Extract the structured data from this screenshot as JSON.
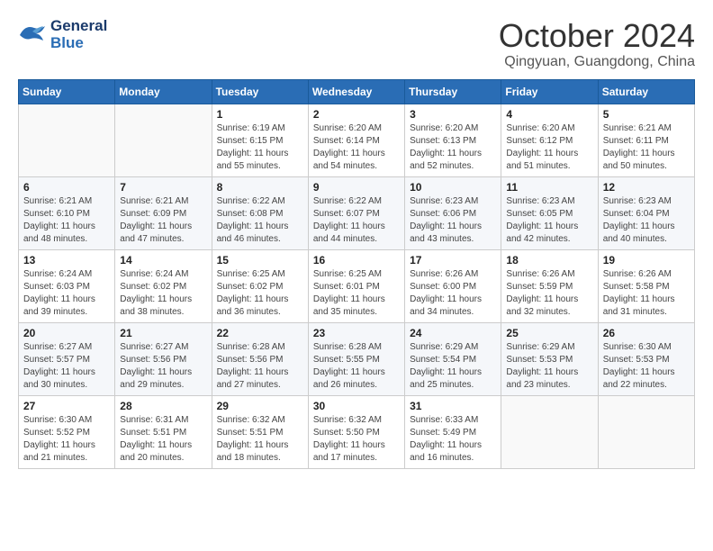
{
  "logo": {
    "line1": "General",
    "line2": "Blue"
  },
  "title": "October 2024",
  "location": "Qingyuan, Guangdong, China",
  "days_of_week": [
    "Sunday",
    "Monday",
    "Tuesday",
    "Wednesday",
    "Thursday",
    "Friday",
    "Saturday"
  ],
  "weeks": [
    [
      {
        "day": "",
        "info": ""
      },
      {
        "day": "",
        "info": ""
      },
      {
        "day": "1",
        "info": "Sunrise: 6:19 AM\nSunset: 6:15 PM\nDaylight: 11 hours and 55 minutes."
      },
      {
        "day": "2",
        "info": "Sunrise: 6:20 AM\nSunset: 6:14 PM\nDaylight: 11 hours and 54 minutes."
      },
      {
        "day": "3",
        "info": "Sunrise: 6:20 AM\nSunset: 6:13 PM\nDaylight: 11 hours and 52 minutes."
      },
      {
        "day": "4",
        "info": "Sunrise: 6:20 AM\nSunset: 6:12 PM\nDaylight: 11 hours and 51 minutes."
      },
      {
        "day": "5",
        "info": "Sunrise: 6:21 AM\nSunset: 6:11 PM\nDaylight: 11 hours and 50 minutes."
      }
    ],
    [
      {
        "day": "6",
        "info": "Sunrise: 6:21 AM\nSunset: 6:10 PM\nDaylight: 11 hours and 48 minutes."
      },
      {
        "day": "7",
        "info": "Sunrise: 6:21 AM\nSunset: 6:09 PM\nDaylight: 11 hours and 47 minutes."
      },
      {
        "day": "8",
        "info": "Sunrise: 6:22 AM\nSunset: 6:08 PM\nDaylight: 11 hours and 46 minutes."
      },
      {
        "day": "9",
        "info": "Sunrise: 6:22 AM\nSunset: 6:07 PM\nDaylight: 11 hours and 44 minutes."
      },
      {
        "day": "10",
        "info": "Sunrise: 6:23 AM\nSunset: 6:06 PM\nDaylight: 11 hours and 43 minutes."
      },
      {
        "day": "11",
        "info": "Sunrise: 6:23 AM\nSunset: 6:05 PM\nDaylight: 11 hours and 42 minutes."
      },
      {
        "day": "12",
        "info": "Sunrise: 6:23 AM\nSunset: 6:04 PM\nDaylight: 11 hours and 40 minutes."
      }
    ],
    [
      {
        "day": "13",
        "info": "Sunrise: 6:24 AM\nSunset: 6:03 PM\nDaylight: 11 hours and 39 minutes."
      },
      {
        "day": "14",
        "info": "Sunrise: 6:24 AM\nSunset: 6:02 PM\nDaylight: 11 hours and 38 minutes."
      },
      {
        "day": "15",
        "info": "Sunrise: 6:25 AM\nSunset: 6:02 PM\nDaylight: 11 hours and 36 minutes."
      },
      {
        "day": "16",
        "info": "Sunrise: 6:25 AM\nSunset: 6:01 PM\nDaylight: 11 hours and 35 minutes."
      },
      {
        "day": "17",
        "info": "Sunrise: 6:26 AM\nSunset: 6:00 PM\nDaylight: 11 hours and 34 minutes."
      },
      {
        "day": "18",
        "info": "Sunrise: 6:26 AM\nSunset: 5:59 PM\nDaylight: 11 hours and 32 minutes."
      },
      {
        "day": "19",
        "info": "Sunrise: 6:26 AM\nSunset: 5:58 PM\nDaylight: 11 hours and 31 minutes."
      }
    ],
    [
      {
        "day": "20",
        "info": "Sunrise: 6:27 AM\nSunset: 5:57 PM\nDaylight: 11 hours and 30 minutes."
      },
      {
        "day": "21",
        "info": "Sunrise: 6:27 AM\nSunset: 5:56 PM\nDaylight: 11 hours and 29 minutes."
      },
      {
        "day": "22",
        "info": "Sunrise: 6:28 AM\nSunset: 5:56 PM\nDaylight: 11 hours and 27 minutes."
      },
      {
        "day": "23",
        "info": "Sunrise: 6:28 AM\nSunset: 5:55 PM\nDaylight: 11 hours and 26 minutes."
      },
      {
        "day": "24",
        "info": "Sunrise: 6:29 AM\nSunset: 5:54 PM\nDaylight: 11 hours and 25 minutes."
      },
      {
        "day": "25",
        "info": "Sunrise: 6:29 AM\nSunset: 5:53 PM\nDaylight: 11 hours and 23 minutes."
      },
      {
        "day": "26",
        "info": "Sunrise: 6:30 AM\nSunset: 5:53 PM\nDaylight: 11 hours and 22 minutes."
      }
    ],
    [
      {
        "day": "27",
        "info": "Sunrise: 6:30 AM\nSunset: 5:52 PM\nDaylight: 11 hours and 21 minutes."
      },
      {
        "day": "28",
        "info": "Sunrise: 6:31 AM\nSunset: 5:51 PM\nDaylight: 11 hours and 20 minutes."
      },
      {
        "day": "29",
        "info": "Sunrise: 6:32 AM\nSunset: 5:51 PM\nDaylight: 11 hours and 18 minutes."
      },
      {
        "day": "30",
        "info": "Sunrise: 6:32 AM\nSunset: 5:50 PM\nDaylight: 11 hours and 17 minutes."
      },
      {
        "day": "31",
        "info": "Sunrise: 6:33 AM\nSunset: 5:49 PM\nDaylight: 11 hours and 16 minutes."
      },
      {
        "day": "",
        "info": ""
      },
      {
        "day": "",
        "info": ""
      }
    ]
  ]
}
